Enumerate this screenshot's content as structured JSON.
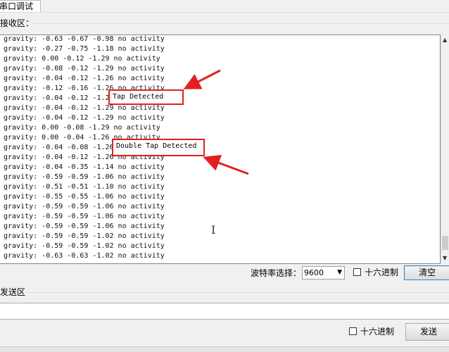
{
  "tab": {
    "label": "串口调试"
  },
  "receive": {
    "section_label": "接收区：",
    "lines": [
      "gravity: -0.63 -0.67 -0.98 no activity",
      "gravity: -0.27 -0.75 -1.18 no activity",
      "gravity: 0.00 -0.12 -1.29 no activity",
      "gravity: -0.08 -0.12 -1.29 no activity",
      "gravity: -0.04 -0.12 -1.26 no activity",
      "gravity: -0.12 -0.16 -1.26 no activity",
      "gravity: -0.04 -0.12 -1.23 Tap Detected",
      "gravity: -0.04 -0.12 -1.29 no activity",
      "gravity: -0.04 -0.12 -1.29 no activity",
      "gravity: 0.00 -0.08 -1.29 no activity",
      "gravity: 0.00 -0.04 -1.26 no activity",
      "gravity: -0.04 -0.08 -1.26 Double Tap Detected",
      "gravity: -0.04 -0.12 -1.26 no activity",
      "gravity: -0.04 -0.35 -1.14 no activity",
      "gravity: -0.59 -0.59 -1.06 no activity",
      "gravity: -0.51 -0.51 -1.10 no activity",
      "gravity: -0.55 -0.55 -1.06 no activity",
      "gravity: -0.59 -0.59 -1.06 no activity",
      "gravity: -0.59 -0.59 -1.06 no activity",
      "gravity: -0.59 -0.59 -1.06 no activity",
      "gravity: -0.59 -0.59 -1.02 no activity",
      "gravity: -0.59 -0.59 -1.02 no activity",
      "gravity: -0.63 -0.63 -1.02 no activity"
    ],
    "callouts": [
      "Tap Detected",
      "Double Tap Detected"
    ],
    "baud_label": "波特率选择：",
    "baud_value": "9600",
    "hex_label": "十六进制",
    "clear_button": "清空"
  },
  "send": {
    "section_label": "发送区",
    "input_value": "",
    "hex_label": "十六进制",
    "send_button": "发送"
  },
  "colors": {
    "annotation": "#e32020",
    "accent_border": "#3c7fb1"
  }
}
